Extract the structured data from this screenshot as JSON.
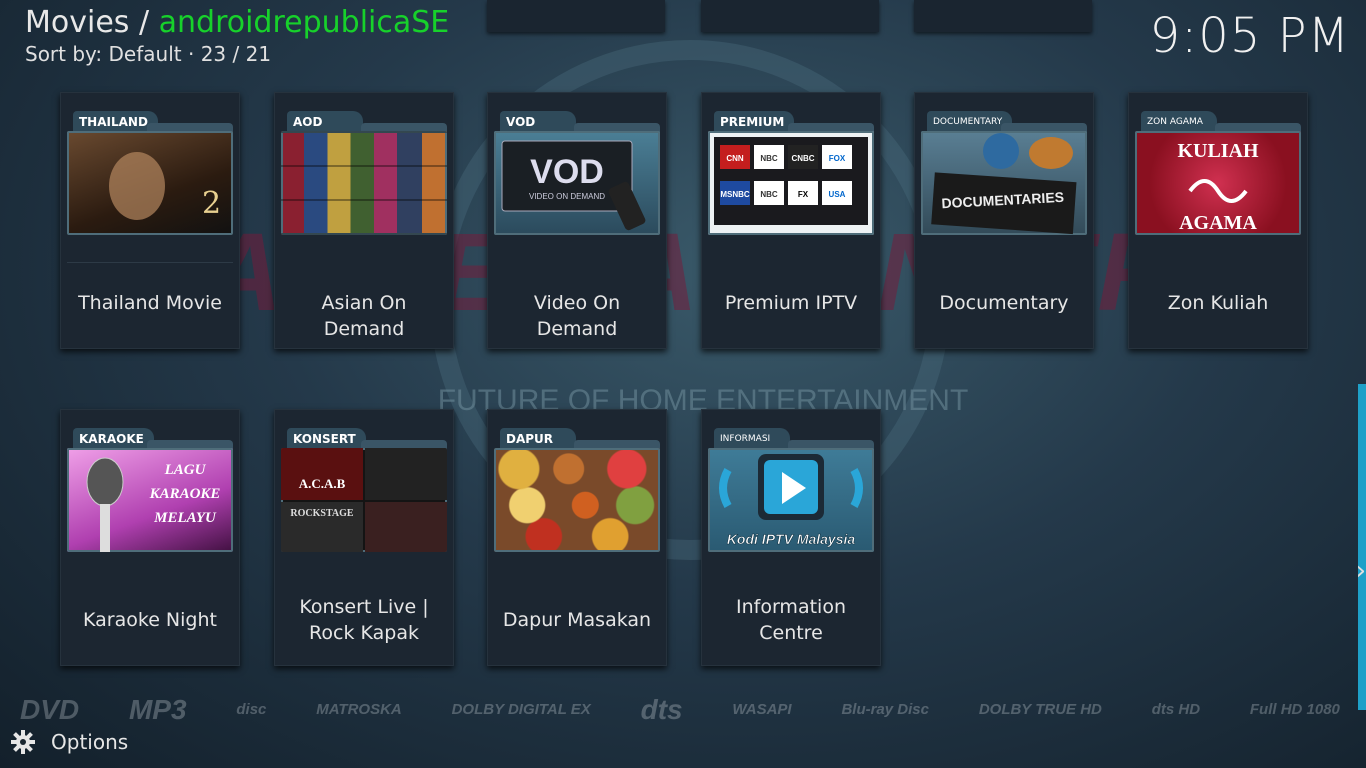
{
  "header": {
    "section": "Movies",
    "separator": "/",
    "source": "androidrepublicaSE",
    "sort_label": "Sort by: Default",
    "dot": "·",
    "position": "23 / 21",
    "clock": "9:05 PM"
  },
  "row1": [
    {
      "tab": "THAILAND",
      "label": "Thailand Movie",
      "thumb_text": "2"
    },
    {
      "tab": "AOD",
      "label": "Asian On Demand"
    },
    {
      "tab": "VOD",
      "label": "Video On Demand",
      "thumb_text": "VOD",
      "thumb_sub": "VIDEO ON DEMAND"
    },
    {
      "tab": "PREMIUM",
      "label": "Premium IPTV",
      "channels": [
        "CNN",
        "NBC",
        "CNBC",
        "FOX",
        "MSNBC",
        "NBC",
        "FX",
        "USA"
      ]
    },
    {
      "tab": "DOCUMENTARY",
      "label": "Documentary",
      "thumb_text": "DOCUMENTARIES"
    },
    {
      "tab": "ZON AGAMA",
      "label": "Zon Kuliah",
      "thumb_text": "KULIAH",
      "thumb_sub": "AGAMA"
    }
  ],
  "row2": [
    {
      "tab": "KARAOKE",
      "label": "Karaoke Night",
      "thumb_lines": [
        "LAGU",
        "KARAOKE",
        "MELAYU"
      ]
    },
    {
      "tab": "KONSERT",
      "label": "Konsert Live | Rock Kapak",
      "thumb_text": "A.C.A.B",
      "thumb_sub": "ROCKSTAGE"
    },
    {
      "tab": "DAPUR",
      "label": "Dapur Masakan"
    },
    {
      "tab": "INFORMASI",
      "label": "Information Centre",
      "thumb_text": "Kodi IPTV Malaysia"
    }
  ],
  "footer_logos": [
    "DVD",
    "MP3",
    "disc",
    "MATROSKA",
    "DOLBY DIGITAL EX",
    "dts",
    "WASAPI",
    "Blu-ray Disc",
    "DOLBY TRUE HD",
    "dts HD",
    "Full HD 1080"
  ],
  "options_label": "Options",
  "colors": {
    "accent": "#17d12b",
    "scroll": "#1ea0c8",
    "card": "#1c2631"
  }
}
